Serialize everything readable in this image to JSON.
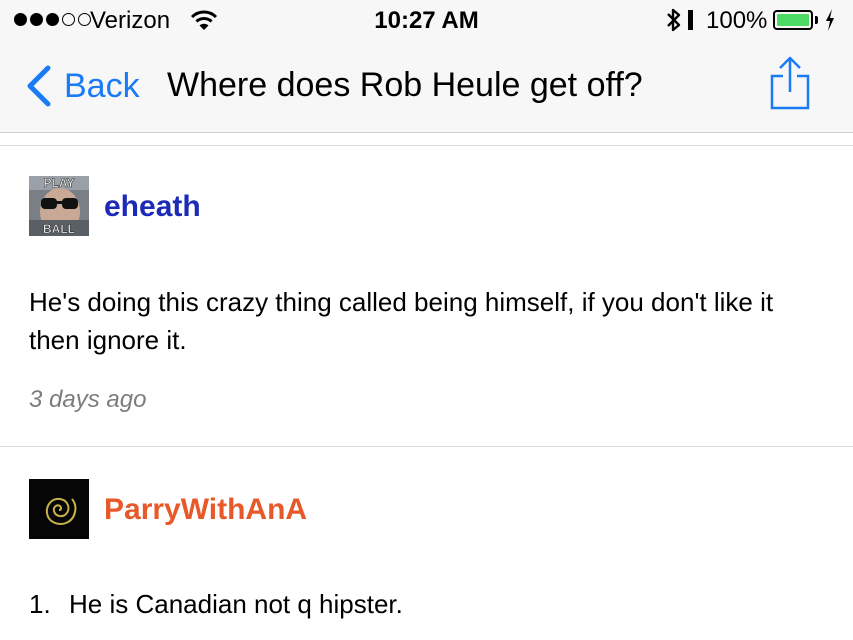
{
  "status_bar": {
    "carrier": "Verizon",
    "time": "10:27 AM",
    "battery_percent": "100%",
    "signal_bars": 3,
    "signal_total": 5
  },
  "nav": {
    "back_label": "Back",
    "title": "Where does Rob Heule get off?",
    "accent_color": "#1a7cf5"
  },
  "comments": [
    {
      "username": "eheath",
      "username_color": "#1b2bb5",
      "avatar_top_text": "PLAY",
      "avatar_bottom_text": "BALL",
      "body": "He's doing this crazy thing called being himself, if you don't like it then ignore it.",
      "timestamp": "3 days ago"
    },
    {
      "username": "ParryWithAnA",
      "username_color": "#e8592a",
      "list": [
        {
          "number": "1.",
          "text": "He is Canadian not q hipster."
        }
      ]
    }
  ]
}
